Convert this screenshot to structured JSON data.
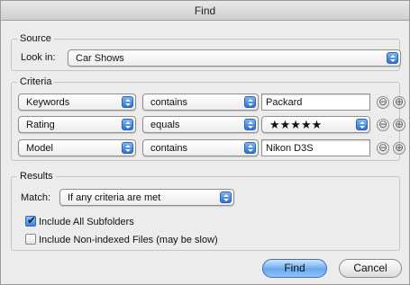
{
  "window": {
    "title": "Find"
  },
  "source": {
    "group_title": "Source",
    "look_in_label": "Look in:",
    "look_in_value": "Car Shows"
  },
  "criteria": {
    "group_title": "Criteria",
    "rows": [
      {
        "field": "Keywords",
        "operator": "contains",
        "value": "Packard",
        "value_type": "text"
      },
      {
        "field": "Rating",
        "operator": "equals",
        "value": "★★★★★",
        "value_type": "popup"
      },
      {
        "field": "Model",
        "operator": "contains",
        "value": "Nikon D3S",
        "value_type": "text"
      }
    ],
    "remove_symbol": "⊖",
    "add_symbol": "⊕"
  },
  "results": {
    "group_title": "Results",
    "match_label": "Match:",
    "match_value": "If any criteria are met",
    "include_subfolders_label": "Include All Subfolders",
    "include_subfolders_checked": true,
    "include_nonindexed_label": "Include Non-indexed Files (may be slow)",
    "include_nonindexed_checked": false
  },
  "buttons": {
    "find": "Find",
    "cancel": "Cancel"
  },
  "colors": {
    "accent": "#3b84e0",
    "window_bg": "#ececec"
  }
}
